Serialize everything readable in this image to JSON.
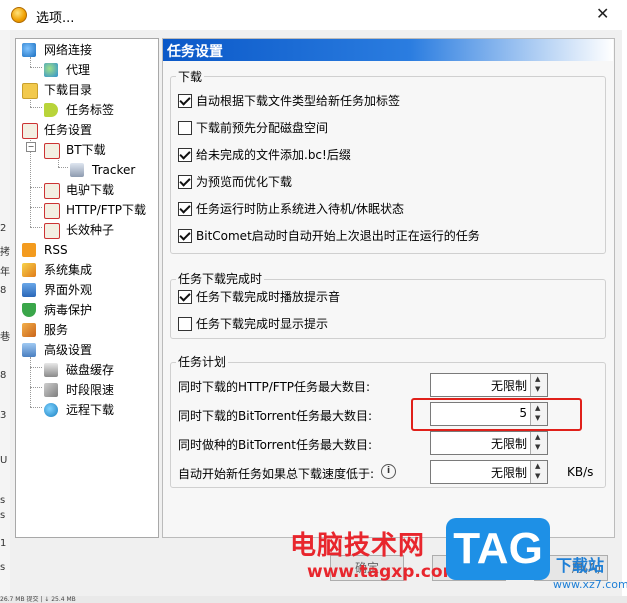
{
  "window": {
    "title": "选项...",
    "close_glyph": "✕"
  },
  "left_edge_fragments": [
    "2",
    "拷",
    "年",
    "8",
    "巷",
    "8",
    "3",
    "U",
    "s",
    "s",
    "1",
    "s"
  ],
  "tree": {
    "items": [
      {
        "label": "网络连接",
        "icon": "globe-icon"
      },
      {
        "label": "代理",
        "icon": "proxy-icon"
      },
      {
        "label": "下载目录",
        "icon": "folder-icon"
      },
      {
        "label": "任务标签",
        "icon": "tag-icon"
      },
      {
        "label": "任务设置",
        "icon": "task-icon"
      },
      {
        "label": "BT下载",
        "icon": "task-icon"
      },
      {
        "label": "Tracker",
        "icon": "server-icon"
      },
      {
        "label": "电驴下载",
        "icon": "task-icon"
      },
      {
        "label": "HTTP/FTP下载",
        "icon": "task-icon"
      },
      {
        "label": "长效种子",
        "icon": "task-icon"
      },
      {
        "label": "RSS",
        "icon": "rss-icon"
      },
      {
        "label": "系统集成",
        "icon": "integration-icon"
      },
      {
        "label": "界面外观",
        "icon": "appearance-icon"
      },
      {
        "label": "病毒保护",
        "icon": "shield-icon"
      },
      {
        "label": "服务",
        "icon": "service-icon"
      },
      {
        "label": "高级设置",
        "icon": "advanced-icon"
      },
      {
        "label": "磁盘缓存",
        "icon": "disk-icon"
      },
      {
        "label": "时段限速",
        "icon": "schedule-icon"
      },
      {
        "label": "远程下载",
        "icon": "remote-icon"
      }
    ]
  },
  "panel": {
    "title": "任务设置",
    "download_group": {
      "label": "下载",
      "options": [
        {
          "label": "自动根据下载文件类型给新任务加标签",
          "checked": true
        },
        {
          "label": "下载前预先分配磁盘空间",
          "checked": false
        },
        {
          "label": "给未完成的文件添加.bc!后缀",
          "checked": true
        },
        {
          "label": "为预览而优化下载",
          "checked": true
        },
        {
          "label": "任务运行时防止系统进入待机/休眠状态",
          "checked": true
        },
        {
          "label": "BitComet启动时自动开始上次退出时正在运行的任务",
          "checked": true
        }
      ]
    },
    "complete_group": {
      "label": "任务下载完成时",
      "options": [
        {
          "label": "任务下载完成时播放提示音",
          "checked": true
        },
        {
          "label": "任务下载完成时显示提示",
          "checked": false
        }
      ]
    },
    "plan_group": {
      "label": "任务计划",
      "fields": [
        {
          "label": "同时下载的HTTP/FTP任务最大数目:",
          "value": "无限制"
        },
        {
          "label": "同时下载的BitTorrent任务最大数目:",
          "value": "5"
        },
        {
          "label": "同时做种的BitTorrent任务最大数目:",
          "value": "无限制"
        },
        {
          "label": "自动开始新任务如果总下载速度低于:",
          "value": "无限制"
        }
      ],
      "speed_unit": "KB/s",
      "info_glyph": "i"
    }
  },
  "buttons": {
    "ok": "确定",
    "cancel": "取",
    "apply": "用(A)"
  },
  "watermark": {
    "title": "电脑技术网",
    "url": "www.tagxp.com",
    "logo": "TAG",
    "site": "下载站",
    "site_url": "www.xz7.com"
  },
  "statusbar": {
    "text": "26.7 MB    提交 | ↓  25.4 MB"
  },
  "colors": {
    "header_blue": "#0a58c8",
    "highlight_red": "#e0201a",
    "watermark_red": "#e8262d",
    "logo_blue": "#1e90e6"
  }
}
